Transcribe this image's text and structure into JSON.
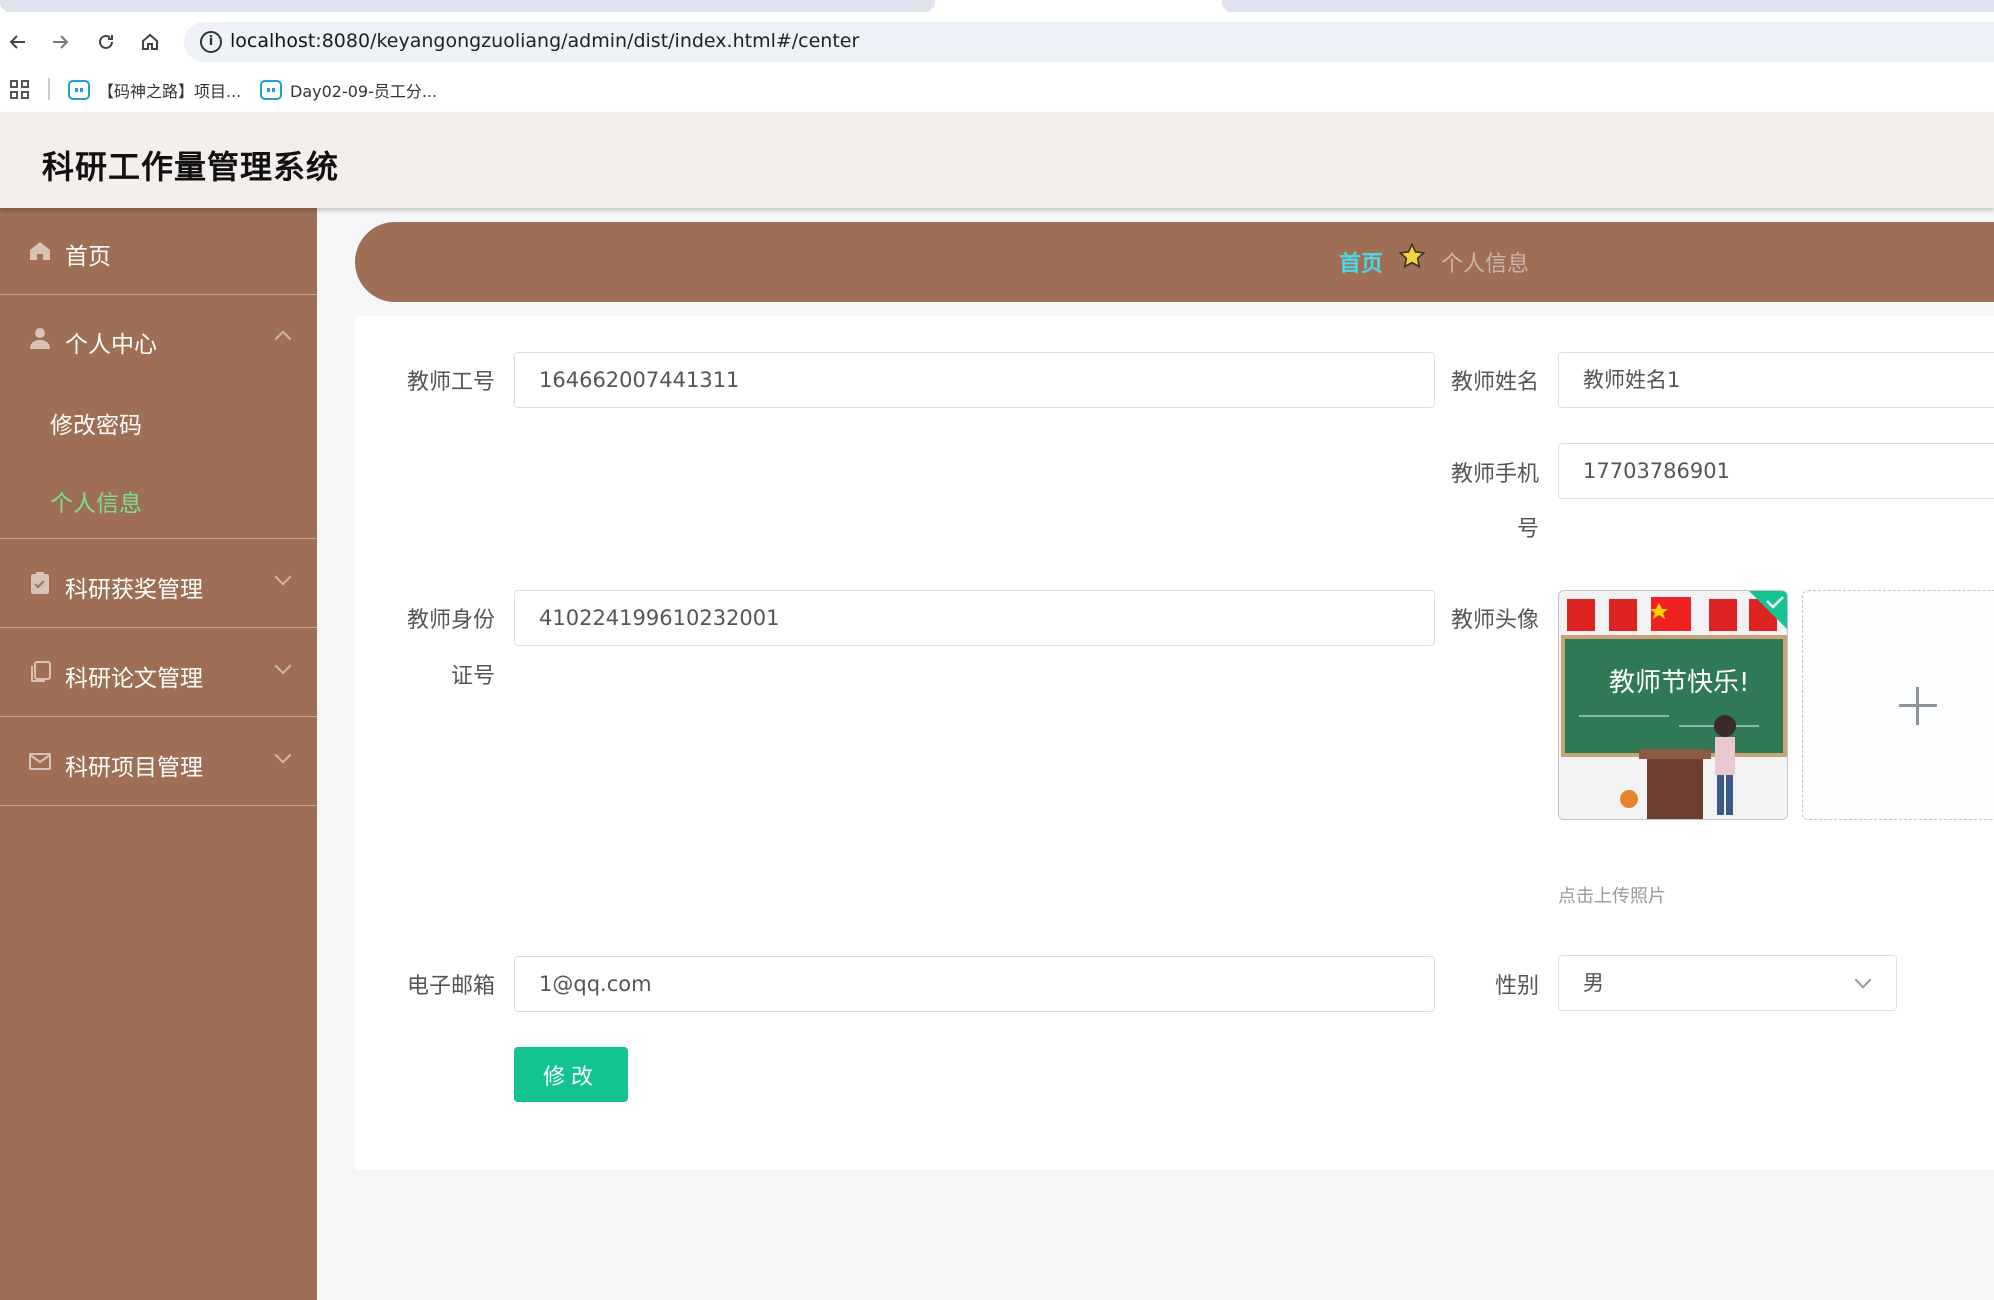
{
  "browser": {
    "url_host": "localhost",
    "url_rest": ":8080/keyangongzuoliang/admin/dist/index.html#/center",
    "bookmarks": [
      "【码神之路】项目...",
      "Day02-09-员工分..."
    ],
    "icons": [
      "back-arrow-icon",
      "forward-arrow-icon",
      "reload-icon",
      "home-icon",
      "info-icon",
      "apps-grid-icon"
    ]
  },
  "header": {
    "title": "科研工作量管理系统"
  },
  "sidebar": {
    "items": [
      {
        "label": "首页",
        "icon": "home-icon"
      },
      {
        "label": "个人中心",
        "icon": "user-icon",
        "expanded": true,
        "children": [
          {
            "label": "修改密码"
          },
          {
            "label": "个人信息",
            "active": true
          }
        ]
      },
      {
        "label": "科研获奖管理",
        "icon": "clipboard-icon"
      },
      {
        "label": "科研论文管理",
        "icon": "copy-icon"
      },
      {
        "label": "科研项目管理",
        "icon": "mail-icon"
      }
    ]
  },
  "breadcrumb": {
    "home": "首页",
    "separator_icon": "star-icon",
    "current": "个人信息"
  },
  "form": {
    "teacher_id": {
      "label": "教师工号",
      "value": "164662007441311"
    },
    "teacher_name": {
      "label": "教师姓名",
      "value": "教师姓名1"
    },
    "phone": {
      "label_line1": "教师手机",
      "label_line2": "号",
      "value": "17703786901"
    },
    "id_card": {
      "label_line1": "教师身份",
      "label_line2": "证号",
      "value": "410224199610232001"
    },
    "avatar": {
      "label": "教师头像",
      "hint": "点击上传照片",
      "image_text": "教师节快乐!"
    },
    "email": {
      "label": "电子邮箱",
      "value": "1@qq.com"
    },
    "gender": {
      "label": "性别",
      "value": "男"
    },
    "submit_label": "修改"
  },
  "colors": {
    "sidebar": "#9e6e55",
    "header": "#f4eeec",
    "accent": "#13c492",
    "active_menu": "#7be08a",
    "crumb_home": "#4fd6e8"
  }
}
